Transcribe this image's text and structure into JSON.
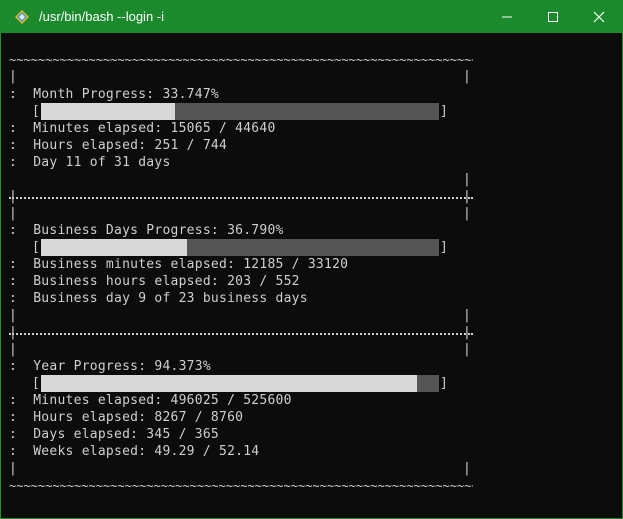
{
  "window": {
    "title": "/usr/bin/bash --login -i",
    "accent": "#1a8a2c",
    "icon": "terminal-icon",
    "controls": [
      "minimize-icon",
      "maximize-icon",
      "close-icon"
    ]
  },
  "terminal": {
    "border_line": "~~~~~~~~~~~~~~~~~~~~~~~~~~~~~~~~~~~~~~~~~~~~~~~~~~~~~~~~~~~~~~~~~~~~~~~~~~~~~~~~~~",
    "edge": "|",
    "open_bracket": "[",
    "close_bracket": "]",
    "month": {
      "title": ":  Month Progress: 33.747%",
      "progress": 0.33747,
      "line1": ":  Minutes elapsed: 15065 / 44640",
      "line2": ":  Hours elapsed: 251 / 744",
      "line3": ":  Day 11 of 31 days"
    },
    "business": {
      "title": ":  Business Days Progress: 36.790%",
      "progress": 0.3679,
      "line1": ":  Business minutes elapsed: 12185 / 33120",
      "line2": ":  Business hours elapsed: 203 / 552",
      "line3": ":  Business day 9 of 23 business days"
    },
    "year": {
      "title": ":  Year Progress: 94.373%",
      "progress": 0.94373,
      "line1": ":  Minutes elapsed: 496025 / 525600",
      "line2": ":  Hours elapsed: 8267 / 8760",
      "line3": ":  Days elapsed: 345 / 365",
      "line4": ":  Weeks elapsed: 49.29 / 52.14"
    }
  }
}
